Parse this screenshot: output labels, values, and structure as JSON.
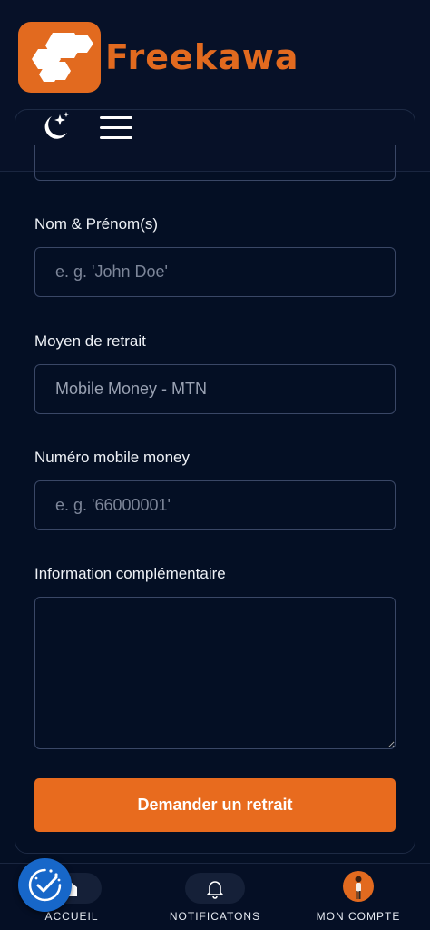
{
  "header": {
    "brand": "Freekawa",
    "colors": {
      "accent": "#e26a1f",
      "background": "#071128"
    },
    "icons": {
      "theme": "moon-stars-icon",
      "menu": "hamburger-menu-icon"
    }
  },
  "form": {
    "full_name": {
      "label": "Nom & Prénom(s)",
      "placeholder": "e. g. 'John Doe'"
    },
    "withdrawal_method": {
      "label": "Moyen de retrait",
      "value": "Mobile Money - MTN"
    },
    "mobile_number": {
      "label": "Numéro mobile money",
      "placeholder": "e. g. '66000001'"
    },
    "extra_info": {
      "label": "Information complémentaire",
      "value": ""
    },
    "submit_label": "Demander un retrait"
  },
  "bottom_nav": {
    "items": [
      {
        "label": "ACCUEIL",
        "icon": "home-icon"
      },
      {
        "label": "NOTIFICATONS",
        "icon": "bell-icon"
      },
      {
        "label": "MON COMPTE",
        "icon": "avatar"
      }
    ]
  },
  "floating_button": {
    "icon": "cookie-consent-check-icon"
  }
}
